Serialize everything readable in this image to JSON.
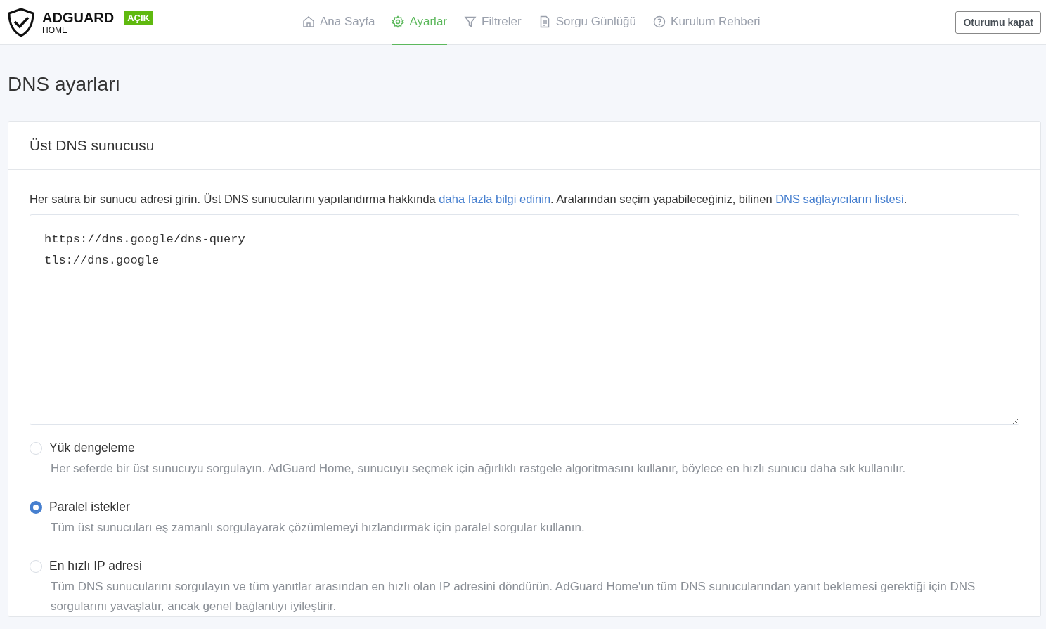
{
  "brand": {
    "name": "ADGUARD",
    "sub": "HOME",
    "badge": "AÇIK"
  },
  "nav": [
    {
      "label": "Ana Sayfa",
      "selected": false
    },
    {
      "label": "Ayarlar",
      "selected": true
    },
    {
      "label": "Filtreler",
      "selected": false
    },
    {
      "label": "Sorgu Günlüğü",
      "selected": false
    },
    {
      "label": "Kurulum Rehberi",
      "selected": false
    }
  ],
  "logout": "Oturumu kapat",
  "page_title": "DNS ayarları",
  "card": {
    "title": "Üst DNS sunucusu",
    "intro": [
      {
        "kind": "text",
        "text": "Her satıra bir sunucu adresi girin. Üst DNS sunucularını yapılandırma hakkında "
      },
      {
        "kind": "link",
        "text": "daha fazla bilgi edinin"
      },
      {
        "kind": "text",
        "text": ". Aralarından seçim yapabileceğiniz, bilinen "
      },
      {
        "kind": "link",
        "text": "DNS sağlayıcıların listesi"
      },
      {
        "kind": "text",
        "text": "."
      }
    ],
    "upstreams": "https://dns.google/dns-query\ntls://dns.google",
    "modes": [
      {
        "label": "Yük dengeleme",
        "description": "Her seferde bir üst sunucuyu sorgulayın. AdGuard Home, sunucuyu seçmek için ağırlıklı rastgele algoritmasını kullanır, böylece en hızlı sunucu daha sık kullanılır.",
        "selected": false
      },
      {
        "label": "Paralel istekler",
        "description": "Tüm üst sunucuları eş zamanlı sorgulayarak çözümlemeyi hızlandırmak için paralel sorgular kullanın.",
        "selected": true
      },
      {
        "label": "En hızlı IP adresi",
        "description": "Tüm DNS sunucularını sorgulayın ve tüm yanıtlar arasından en hızlı olan IP adresini döndürün. AdGuard Home'un tüm DNS sunucularından yanıt beklemesi gerektiği için DNS sorgularını yavaşlatır, ancak genel bağlantıyı iyileştirir.",
        "selected": false
      }
    ]
  }
}
